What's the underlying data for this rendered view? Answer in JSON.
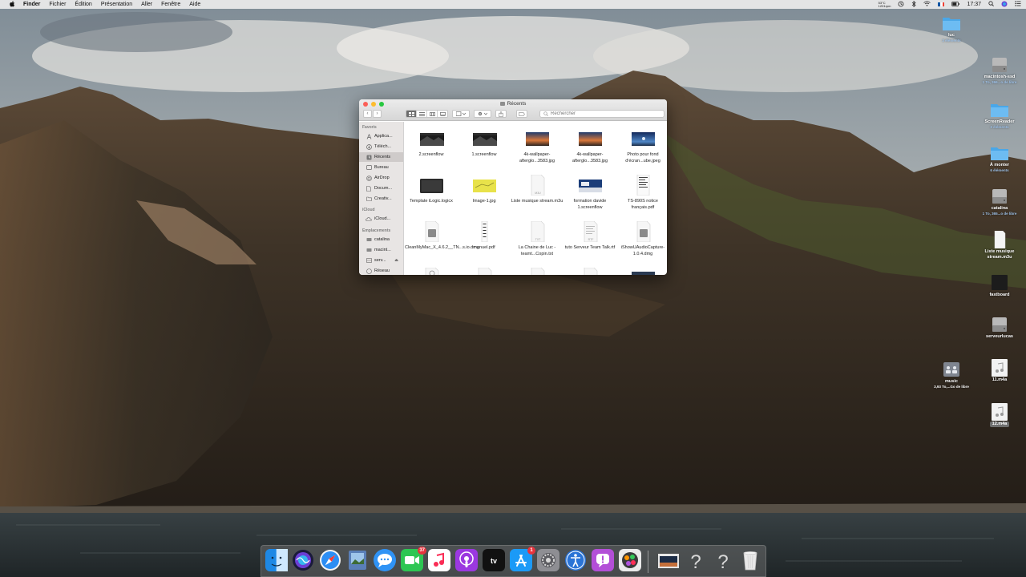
{
  "menubar": {
    "apple": "",
    "items": [
      "Finder",
      "Fichier",
      "Édition",
      "Présentation",
      "Aller",
      "Fenêtre",
      "Aide"
    ],
    "status": {
      "temperature": "53°C",
      "rpm": "1201rpm",
      "time": "17:37"
    }
  },
  "finder": {
    "title": "Récents",
    "search_placeholder": "Rechercher",
    "sidebar": {
      "favorites_header": "Favoris",
      "favorites": [
        "Applica...",
        "Téléch...",
        "Récents",
        "Bureau",
        "AirDrop",
        "Docum...",
        "Creativ..."
      ],
      "icloud_header": "iCloud",
      "icloud": [
        "iCloud..."
      ],
      "locations_header": "Emplacements",
      "locations": [
        "catalina",
        "macint...",
        "serv...",
        "Réseau"
      ]
    },
    "files": [
      {
        "name": "2.screenflow",
        "kind": "video-dark"
      },
      {
        "name": "1.screenflow",
        "kind": "video-dark"
      },
      {
        "name": "4k-wallpaper-afterglo...3583.jpg",
        "kind": "photo-sunset"
      },
      {
        "name": "4k-wallpaper-afterglo...3583.jpg",
        "kind": "photo-sunset"
      },
      {
        "name": "Photo pour fond d'écran...ube.jpeg",
        "kind": "photo-blue"
      },
      {
        "name": "Template iLogic.logicx",
        "kind": "logic"
      },
      {
        "name": "Image-1.jpg",
        "kind": "image-yellow"
      },
      {
        "name": "Liste musique stream.m3u",
        "kind": "doc-m3u"
      },
      {
        "name": "formation davide 1.screenflow",
        "kind": "video-blue"
      },
      {
        "name": "TS-890S notice français.pdf",
        "kind": "doc-pdf"
      },
      {
        "name": "CleanMyMac_X_4.6.2__TN...s.io.dmg",
        "kind": "dmg"
      },
      {
        "name": "manuel.pdf",
        "kind": "doc-manual"
      },
      {
        "name": "La Chaine de Luc - teamt...Copin.txt",
        "kind": "doc-txt"
      },
      {
        "name": "tuto Serveur Team Talk.rtf",
        "kind": "doc-rtf"
      },
      {
        "name": "iShowUAudioCapture-1.0.4.dmg",
        "kind": "dmg"
      }
    ]
  },
  "desktop": [
    {
      "label": "luc",
      "sub": "3 éléments",
      "kind": "folder"
    },
    {
      "label": "macintosh-ssd",
      "sub": "1 To, 366...o de libre",
      "kind": "drive"
    },
    {
      "label": "ScreenReader",
      "sub": "3 éléments",
      "kind": "folder"
    },
    {
      "label": "À monter",
      "sub": "6 éléments",
      "kind": "folder"
    },
    {
      "label": "catalina",
      "sub": "1 To, 365...o de libre",
      "kind": "drive"
    },
    {
      "label": "Liste musique stream.m3u",
      "sub": "",
      "kind": "doc"
    },
    {
      "label": "fastboard",
      "sub": "",
      "kind": "black"
    },
    {
      "label": "serveurlucas",
      "sub": "",
      "kind": "drive"
    },
    {
      "label": "music",
      "sub": "3,93 To,...Go de libre",
      "kind": "network"
    },
    {
      "label": "11.m4a",
      "sub": "",
      "kind": "audio"
    },
    {
      "label": "12.m4a",
      "sub": "",
      "kind": "audio"
    }
  ],
  "dock": {
    "apps": [
      {
        "name": "Finder",
        "badge": ""
      },
      {
        "name": "Siri",
        "badge": ""
      },
      {
        "name": "Safari",
        "badge": ""
      },
      {
        "name": "Preview",
        "badge": ""
      },
      {
        "name": "Messages",
        "badge": ""
      },
      {
        "name": "FaceTime",
        "badge": "37"
      },
      {
        "name": "Music",
        "badge": ""
      },
      {
        "name": "Podcasts",
        "badge": ""
      },
      {
        "name": "TV",
        "badge": ""
      },
      {
        "name": "App Store",
        "badge": "1"
      },
      {
        "name": "System Preferences",
        "badge": ""
      },
      {
        "name": "Accessibility",
        "badge": ""
      },
      {
        "name": "Feedback",
        "badge": ""
      },
      {
        "name": "Motion",
        "badge": ""
      },
      {
        "name": "Downloads",
        "badge": ""
      },
      {
        "name": "Unknown",
        "badge": ""
      },
      {
        "name": "Unknown",
        "badge": ""
      },
      {
        "name": "Trash",
        "badge": ""
      }
    ]
  },
  "colors": {
    "accent_blue": "#4aa7e8",
    "badge_red": "#e8333d",
    "selection": "#cfcbca"
  }
}
